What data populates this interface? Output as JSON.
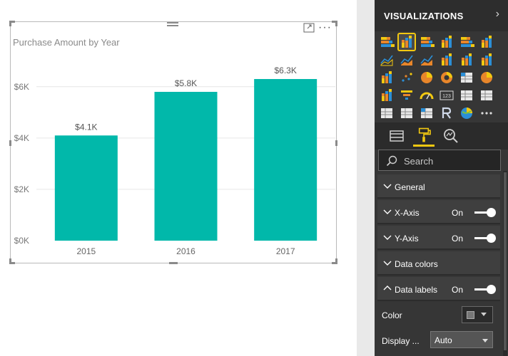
{
  "report": {
    "visual": {
      "title": "Purchase Amount by Year",
      "more_label": "···"
    }
  },
  "chart_data": {
    "type": "bar",
    "title": "Purchase Amount by Year",
    "categories": [
      "2015",
      "2016",
      "2017"
    ],
    "values": [
      4100,
      5800,
      6300
    ],
    "data_labels": [
      "$4.1K",
      "$5.8K",
      "$6.3K"
    ],
    "y_ticks": [
      {
        "value": 0,
        "label": "$0K"
      },
      {
        "value": 2000,
        "label": "$2K"
      },
      {
        "value": 4000,
        "label": "$4K"
      },
      {
        "value": 6000,
        "label": "$6K"
      }
    ],
    "ylim": [
      0,
      6300
    ],
    "grid": true,
    "bar_color": "#01b8aa"
  },
  "pane": {
    "title": "VISUALIZATIONS",
    "chevron": "›",
    "search_placeholder": "Search",
    "sections": [
      {
        "label": "General",
        "expanded": false
      },
      {
        "label": "X-Axis",
        "expanded": false,
        "state": "On"
      },
      {
        "label": "Y-Axis",
        "expanded": false,
        "state": "On"
      },
      {
        "label": "Data colors",
        "expanded": false
      },
      {
        "label": "Data labels",
        "expanded": true,
        "state": "On"
      }
    ],
    "props": {
      "color_label": "Color",
      "display_label": "Display ...",
      "display_value": "Auto"
    },
    "accent": "#f2c811"
  }
}
